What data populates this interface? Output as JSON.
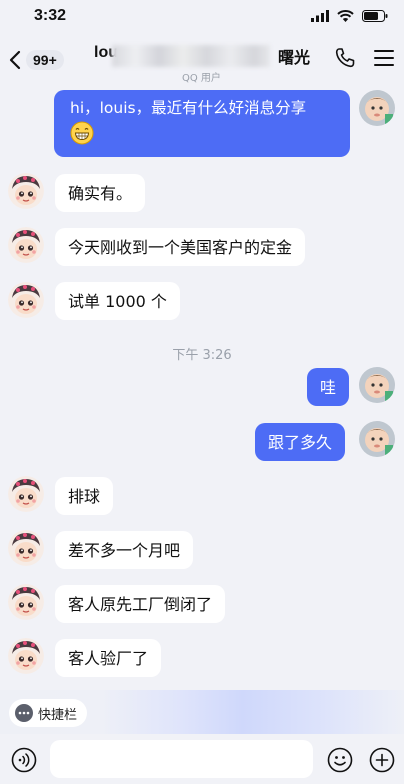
{
  "status_bar": {
    "time": "3:32"
  },
  "nav": {
    "back_badge": "99+",
    "title_prefix": "lou",
    "title_suffix": "曙光",
    "subtitle": "QQ 用户"
  },
  "messages": [
    {
      "from": "me",
      "text": "hi，louis，最近有什么好消息分享"
    },
    {
      "from": "them",
      "text": "确实有。"
    },
    {
      "from": "them",
      "text": "今天刚收到一个美国客户的定金"
    },
    {
      "from": "them",
      "text": "试单 1000 个"
    },
    {
      "from": "me",
      "text": "哇"
    },
    {
      "from": "me",
      "text": "跟了多久"
    },
    {
      "from": "them",
      "text": "排球"
    },
    {
      "from": "them",
      "text": "差不多一个月吧"
    },
    {
      "from": "them",
      "text": "客人原先工厂倒闭了"
    },
    {
      "from": "them",
      "text": "客人验厂了"
    }
  ],
  "timestamp": "下午 3:26",
  "quickbar": {
    "label": "快捷栏"
  },
  "input": {
    "value": "",
    "placeholder": ""
  },
  "colors": {
    "accent": "#4d6cf5",
    "background": "#f1f2f7"
  },
  "icons": {
    "back": "chevron-left-icon",
    "phone": "phone-icon",
    "menu": "menu-icon",
    "voice": "voice-icon",
    "emoji": "emoji-icon",
    "plus": "plus-icon",
    "quickbar": "dots-icon",
    "grin": "grin-emoji-icon"
  }
}
